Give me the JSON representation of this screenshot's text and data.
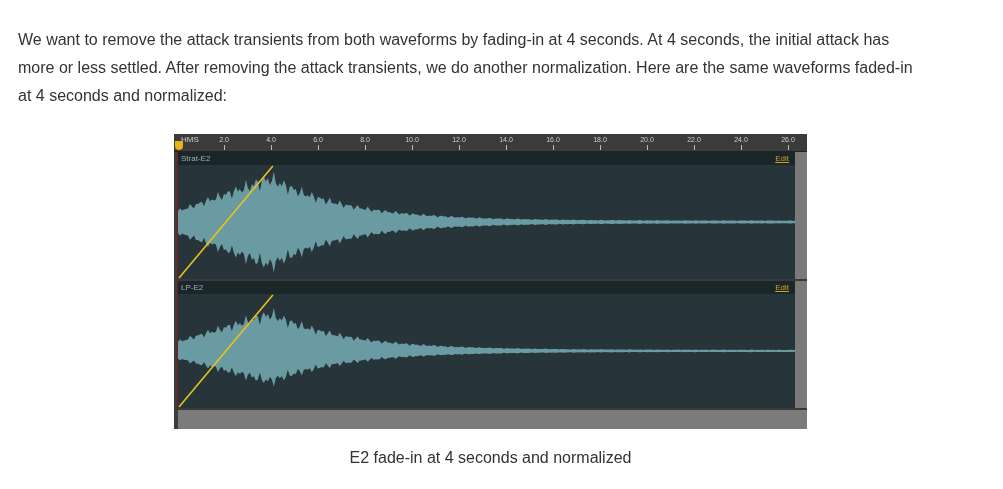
{
  "paragraph": "We want to remove the attack transients from both waveforms by fading-in at 4 seconds. At 4 seconds, the initial attack has more or less settled. After removing the attack transients, we do another normalization. Here are the same waveforms faded-in at 4 seconds and normalized:",
  "editor": {
    "ruler": {
      "unit_label": "HMS",
      "ticks": [
        "2.0",
        "4.0",
        "6.0",
        "8.0",
        "10.0",
        "12.0",
        "14.0",
        "16.0",
        "18.0",
        "20.0",
        "22.0",
        "24.0",
        "26.0"
      ]
    },
    "tracks": [
      {
        "name": "Strat-E2",
        "edit_label": "Edit",
        "kind": "symmetric"
      },
      {
        "name": "LP-E2",
        "edit_label": "Edit",
        "kind": "asymmetric"
      }
    ]
  },
  "caption": "E2 fade-in at 4 seconds and normalized"
}
